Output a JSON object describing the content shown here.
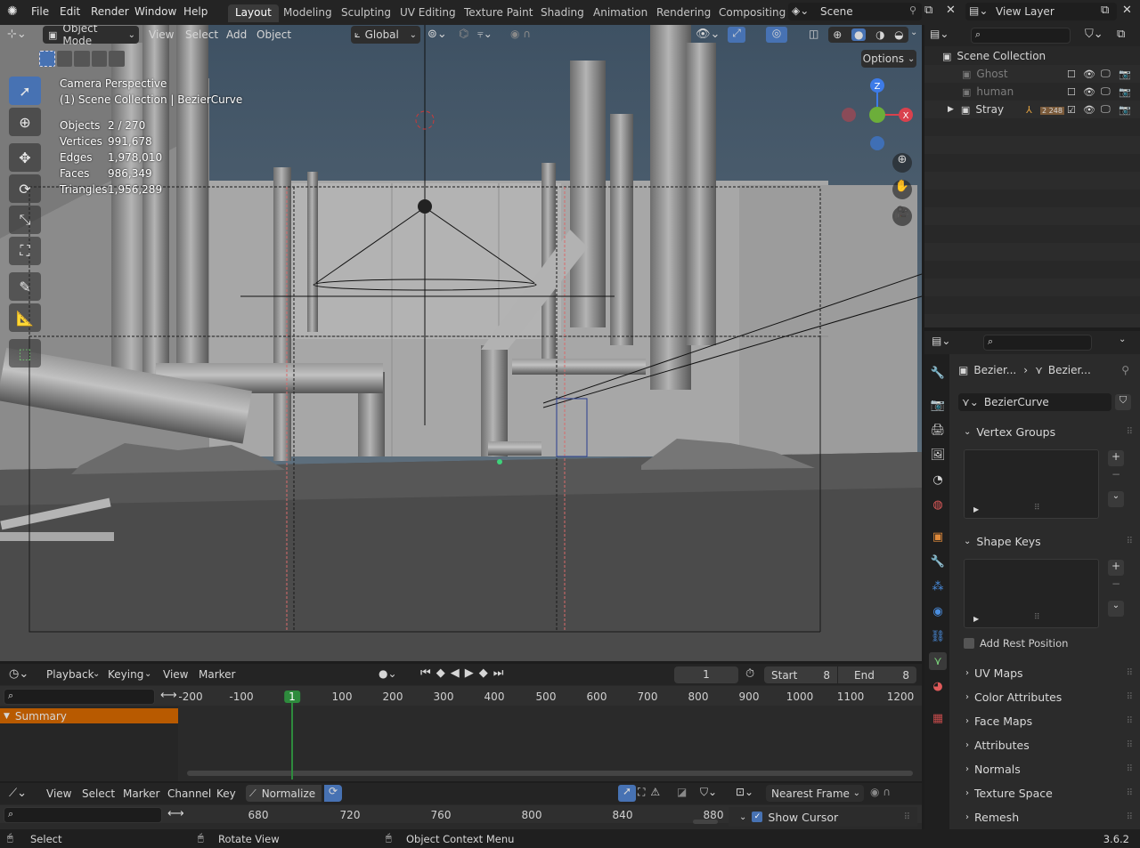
{
  "app": {
    "version": "3.6.2"
  },
  "menus": [
    "File",
    "Edit",
    "Render",
    "Window",
    "Help"
  ],
  "workspaces": [
    "Layout",
    "Modeling",
    "Sculpting",
    "UV Editing",
    "Texture Paint",
    "Shading",
    "Animation",
    "Rendering",
    "Compositing"
  ],
  "active_workspace": "Layout",
  "scene": {
    "name": "Scene",
    "view_layer": "View Layer"
  },
  "viewport": {
    "mode": "Object Mode",
    "menus": [
      "View",
      "Select",
      "Add",
      "Object"
    ],
    "orientation": "Global",
    "options_label": "Options",
    "overlay_title": "Camera Perspective",
    "overlay_subtitle": "(1) Scene Collection | BezierCurve",
    "stats": [
      {
        "label": "Objects",
        "value": "2 / 270"
      },
      {
        "label": "Vertices",
        "value": "991,678"
      },
      {
        "label": "Edges",
        "value": "1,978,010"
      },
      {
        "label": "Faces",
        "value": "986,349"
      },
      {
        "label": "Triangles",
        "value": "1,956,289"
      }
    ],
    "gizmo": {
      "z": "Z",
      "x": "X"
    }
  },
  "outliner": {
    "root": "Scene Collection",
    "items": [
      {
        "label": "Ghost",
        "dim": true
      },
      {
        "label": "human",
        "dim": true
      },
      {
        "label": "Stray",
        "dim": false,
        "badge": "2 248"
      }
    ]
  },
  "properties": {
    "breadcrumb": [
      "Bezier...",
      "Bezier..."
    ],
    "datablock": "BezierCurve",
    "panels": {
      "vertex_groups": "Vertex Groups",
      "shape_keys": "Shape Keys",
      "add_rest_position": "Add Rest Position",
      "collapsed": [
        "UV Maps",
        "Color Attributes",
        "Face Maps",
        "Attributes",
        "Normals",
        "Texture Space",
        "Remesh"
      ]
    }
  },
  "timeline": {
    "menus": [
      "Playback",
      "Keying",
      "View",
      "Marker"
    ],
    "current_frame": "1",
    "start_label": "Start",
    "start": "8",
    "end_label": "End",
    "end": "8",
    "ruler": [
      "-200",
      "-100",
      "1",
      "100",
      "200",
      "300",
      "400",
      "500",
      "600",
      "700",
      "800",
      "900",
      "1000",
      "1100",
      "1200"
    ],
    "summary": "Summary"
  },
  "graph_editor": {
    "menus": [
      "View",
      "Select",
      "Marker",
      "Channel",
      "Key"
    ],
    "normalize": "Normalize",
    "snap": "Nearest Frame",
    "ruler": [
      "680",
      "720",
      "760",
      "800",
      "840",
      "880"
    ],
    "show_cursor": "Show Cursor"
  },
  "status_bar": {
    "select": "Select",
    "rotate": "Rotate View",
    "context": "Object Context Menu"
  },
  "colors": {
    "accent": "#4772b3",
    "summary": "#b85a00",
    "frame_marker": "#2e8b3d",
    "x_axis": "#d9414d",
    "z_axis": "#3d7be8",
    "y_axis": "#6cae3a"
  }
}
